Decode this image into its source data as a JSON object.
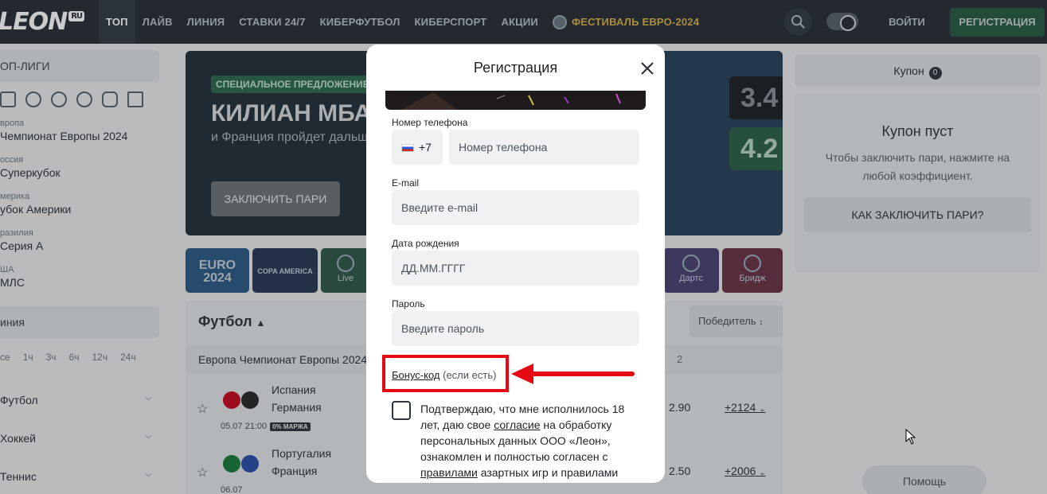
{
  "header": {
    "logo": "LEON",
    "logo_suffix": "RU",
    "nav": [
      "ТОП",
      "ЛАЙВ",
      "ЛИНИЯ",
      "СТАВКИ 24/7",
      "КИБЕРФУТБОЛ",
      "КИБЕРСПОРТ",
      "АКЦИИ",
      "ФЕСТИВАЛЬ ЕВРО-2024"
    ],
    "login": "ВОЙТИ",
    "register": "РЕГИСТРАЦИЯ"
  },
  "sidebar": {
    "top_leagues_title": "ОП-ЛИГИ",
    "leagues": [
      {
        "country": "вропа",
        "name": "Чемпионат Европы 2024"
      },
      {
        "country": "оссия",
        "name": "Суперкубок"
      },
      {
        "country": "мерика",
        "name": "убок Америки"
      },
      {
        "country": "разилия",
        "name": "Серия А"
      },
      {
        "country": "ША",
        "name": "МЛС"
      }
    ],
    "line_title": "иния",
    "hours": [
      "се",
      "1ч",
      "3ч",
      "6ч",
      "12ч",
      "24ч"
    ],
    "sports": [
      "Футбол",
      "Хоккей",
      "Теннис"
    ]
  },
  "banner": {
    "tag": "СПЕЦИАЛЬНОЕ ПРЕДЛОЖЕНИЕ",
    "title": "КИЛИАН МБАПП",
    "subtitle": "и Франция пройдет дальше",
    "button": "ЗАКЛЮЧИТЬ ПАРИ",
    "odd_a": "3.4",
    "odd_b": "4.2"
  },
  "tiles": [
    {
      "title": "EURO 2024",
      "label": ""
    },
    {
      "title": "COPA AMERICA",
      "label": ""
    },
    {
      "title": "",
      "label": "Live"
    },
    {
      "title": "",
      "label": "Дартс"
    },
    {
      "title": "",
      "label": "Бридж"
    }
  ],
  "events": {
    "title": "Футбол",
    "market": "Победитель",
    "league": "Европа Чемпионат Европы 2024",
    "col_2": "2",
    "matches": [
      {
        "home": "Испания",
        "away": "Германия",
        "date": "05.07",
        "time": "21:00",
        "badge": "0% МАРЖА",
        "odd": "2.90",
        "more": "+2124"
      },
      {
        "home": "Португалия",
        "away": "Франция",
        "date": "06.07",
        "time": "",
        "badge": "",
        "odd": "2.50",
        "more": "+2006"
      }
    ]
  },
  "coupon": {
    "tab": "Купон",
    "count": "0",
    "empty_title": "Купон пуст",
    "empty_text": "Чтобы заключить пари, нажмите на любой коэффициент.",
    "how_button": "КАК ЗАКЛЮЧИТЬ ПАРИ?",
    "help": "Помощь"
  },
  "modal": {
    "title": "Регистрация",
    "phone_label": "Номер телефона",
    "phone_code": "+7",
    "phone_placeholder": "Номер телефона",
    "email_label": "E-mail",
    "email_placeholder": "Введите e-mail",
    "birth_label": "Дата рождения",
    "birth_placeholder": "ДД.ММ.ГГГГ",
    "password_label": "Пароль",
    "password_placeholder": "Введите пароль",
    "bonus_link": "Бонус-код",
    "bonus_hint": "(если есть)",
    "consent_1": "Подтверждаю, что мне исполнилось 18 лет, даю свое",
    "consent_link_1": "согласие",
    "consent_2": "на обработку персональных данных ООО «Леон», ознакомлен и полностью согласен с",
    "consent_link_2": "правилами",
    "consent_3": "азартных игр и правилами"
  },
  "colors": {
    "header_bg": "#2a3036",
    "register_green": "#2a5c43",
    "annotation_red": "#e50914",
    "field_bg": "#eff1f2"
  }
}
